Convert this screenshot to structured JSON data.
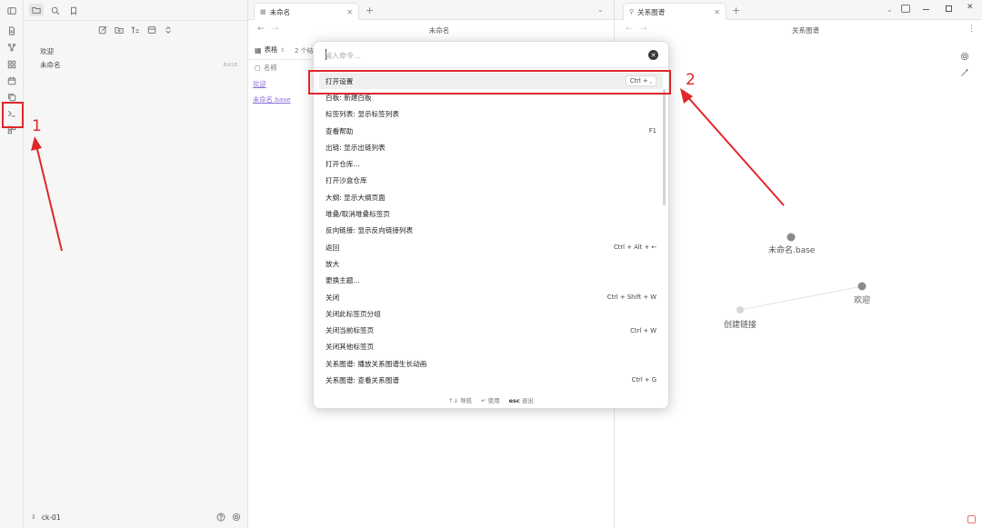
{
  "left_ribbon": {
    "icons": [
      "sidebar-toggle-icon",
      "file-icon",
      "graph-icon",
      "grid-icon",
      "calendar-icon",
      "copy-icon",
      "terminal-icon",
      "blocks-icon"
    ]
  },
  "file_explorer": {
    "top_icons": [
      "folder-icon",
      "search-icon",
      "bookmark-icon"
    ],
    "action_icons": [
      "edit-icon",
      "new-folder-icon",
      "sort-icon",
      "collapse-icon",
      "expand-icon"
    ],
    "items": [
      {
        "label": "欢迎",
        "badge": ""
      },
      {
        "label": "未命名",
        "badge": "BASE"
      }
    ],
    "vault_name": "ck-01"
  },
  "middle_pane": {
    "tab_label": "未命名",
    "title": "未命名",
    "view_label": "表格",
    "count_label": "2 个结",
    "column_header": "名称",
    "rows": [
      "欢迎",
      "未命名.base"
    ]
  },
  "right_pane": {
    "tab_label": "关系图谱",
    "title": "关系图谱",
    "nodes": [
      "未命名.base",
      "欢迎",
      "创建链接"
    ]
  },
  "command_palette": {
    "placeholder": "输入命令...",
    "items": [
      {
        "label": "打开设置",
        "hotkey": "Ctrl + ,"
      },
      {
        "label": "白板: 新建白板",
        "hotkey": ""
      },
      {
        "label": "标签列表: 显示标签列表",
        "hotkey": ""
      },
      {
        "label": "查看帮助",
        "hotkey": "F1"
      },
      {
        "label": "出链: 显示出链列表",
        "hotkey": ""
      },
      {
        "label": "打开仓库...",
        "hotkey": ""
      },
      {
        "label": "打开沙盒仓库",
        "hotkey": ""
      },
      {
        "label": "大纲: 显示大纲页面",
        "hotkey": ""
      },
      {
        "label": "堆叠/取消堆叠标签页",
        "hotkey": ""
      },
      {
        "label": "反向链接: 显示反向链接列表",
        "hotkey": ""
      },
      {
        "label": "返回",
        "hotkey": "Ctrl + Alt + ←"
      },
      {
        "label": "放大",
        "hotkey": ""
      },
      {
        "label": "更换主题...",
        "hotkey": ""
      },
      {
        "label": "关闭",
        "hotkey": "Ctrl + Shift + W"
      },
      {
        "label": "关闭此标签页分组",
        "hotkey": ""
      },
      {
        "label": "关闭当前标签页",
        "hotkey": "Ctrl + W"
      },
      {
        "label": "关闭其他标签页",
        "hotkey": ""
      },
      {
        "label": "关系图谱: 播放关系图谱生长动画",
        "hotkey": ""
      },
      {
        "label": "关系图谱: 查看关系图谱",
        "hotkey": "Ctrl + G"
      }
    ],
    "footer": {
      "navigate_key": "↑↓",
      "navigate_label": "导航",
      "use_key": "↵",
      "use_label": "使用",
      "exit_key": "esc",
      "exit_label": "退出"
    }
  },
  "annotations": {
    "number_1": "1",
    "number_2": "2",
    "color": "#e0262b"
  }
}
